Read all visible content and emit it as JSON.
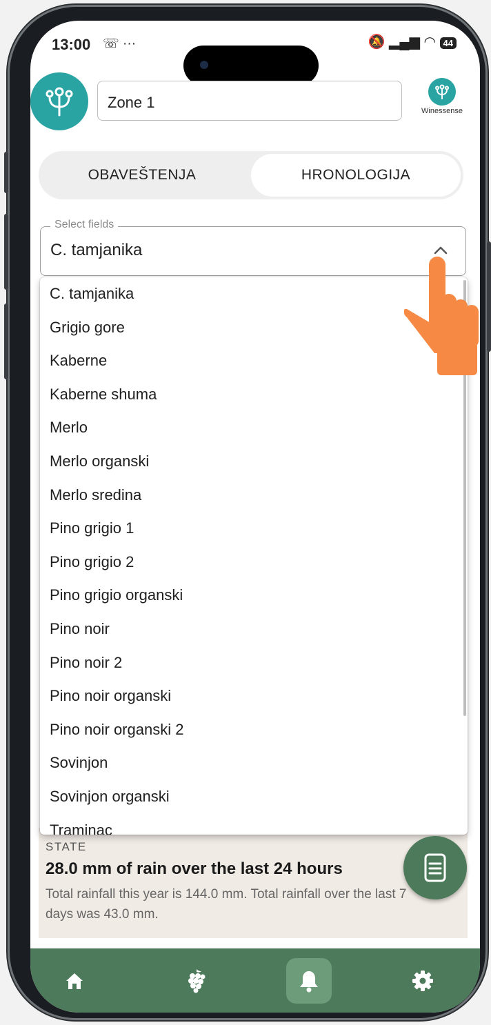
{
  "status_bar": {
    "time": "13:00",
    "left_icons": "☏ ···",
    "right_icons": "🔕 ▂▄▆ ◠ ",
    "battery": "44"
  },
  "header": {
    "zone_value": "Zone 1",
    "brand_name": "Winessense"
  },
  "tabs": [
    {
      "label": "OBAVEŠTENJA",
      "active": false
    },
    {
      "label": "HRONOLOGIJA",
      "active": true
    }
  ],
  "select": {
    "legend": "Select fields",
    "value": "C. tamjanika",
    "options": [
      "C. tamjanika",
      "Grigio gore",
      "Kaberne",
      "Kaberne shuma",
      "Merlo",
      "Merlo organski",
      "Merlo sredina",
      "Pino grigio 1",
      "Pino grigio 2",
      "Pino grigio organski",
      "Pino noir",
      "Pino noir 2",
      "Pino noir organski",
      "Pino noir organski 2",
      "Sovinjon",
      "Sovinjon organski",
      "Traminac"
    ]
  },
  "state_card": {
    "label": "STATE",
    "title": "28.0 mm of rain over the last 24 hours",
    "description": "Total rainfall this year is 144.0 mm. Total rainfall over the last 7 days was 43.0 mm."
  },
  "bottom_nav": [
    {
      "icon": "home-icon",
      "active": false
    },
    {
      "icon": "grapes-icon",
      "active": false
    },
    {
      "icon": "bell-icon",
      "active": true
    },
    {
      "icon": "gear-icon",
      "active": false
    }
  ],
  "colors": {
    "brand_teal": "#2aa3a3",
    "nav_green": "#4c7a5a",
    "nav_active": "#6c9c7a",
    "card_bg": "#f1ebe5",
    "hand": "#f68a45"
  }
}
